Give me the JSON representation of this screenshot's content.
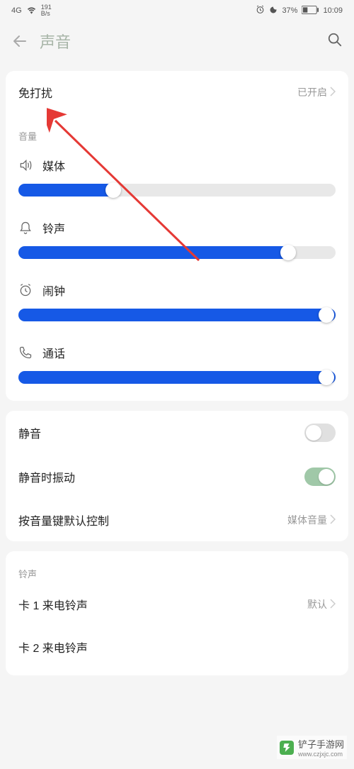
{
  "status_bar": {
    "network_type": "4G",
    "speed_value": "191",
    "speed_unit": "B/s",
    "battery_pct": "37%",
    "time": "10:09"
  },
  "header": {
    "title": "声音"
  },
  "dnd": {
    "label": "免打扰",
    "status": "已开启"
  },
  "volume": {
    "section_title": "音量",
    "sliders": [
      {
        "label": "媒体",
        "value": 30
      },
      {
        "label": "铃声",
        "value": 85
      },
      {
        "label": "闹钟",
        "value": 100
      },
      {
        "label": "通话",
        "value": 100
      }
    ]
  },
  "toggles": {
    "mute": {
      "label": "静音",
      "on": false
    },
    "vibrate_on_mute": {
      "label": "静音时振动",
      "on": true
    },
    "vol_key_control": {
      "label": "按音量键默认控制",
      "value": "媒体音量"
    }
  },
  "ringtone": {
    "section_title": "铃声",
    "sim1": {
      "label": "卡 1 来电铃声",
      "value": "默认"
    },
    "sim2": {
      "label": "卡 2 来电铃声"
    }
  },
  "watermark": {
    "name": "铲子手游网",
    "url": "www.czjxjc.com"
  }
}
